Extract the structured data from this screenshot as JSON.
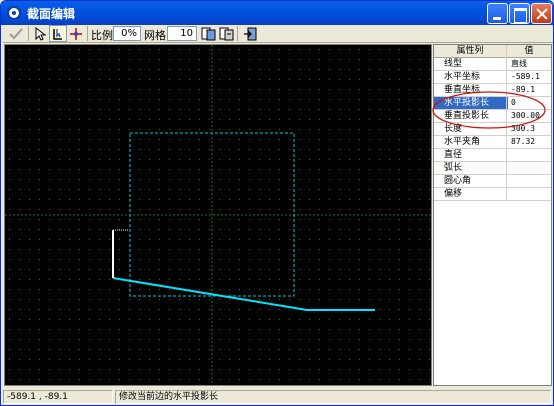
{
  "window": {
    "title": "截面编辑"
  },
  "toolbar": {
    "scale_label": "比例",
    "scale_value": "0%",
    "grid_label": "网格",
    "grid_value": "10"
  },
  "properties": {
    "headers": [
      "属性列",
      "值"
    ],
    "rows": [
      {
        "name": "线型",
        "value": "直线"
      },
      {
        "name": "水平坐标",
        "value": "-589.1"
      },
      {
        "name": "垂直坐标",
        "value": "-89.1"
      },
      {
        "name": "水平投影长",
        "value": "0"
      },
      {
        "name": "垂直投影长",
        "value": "300.00"
      },
      {
        "name": "长度",
        "value": "300.3"
      },
      {
        "name": "水平夹角",
        "value": "87.32"
      },
      {
        "name": "直径",
        "value": ""
      },
      {
        "name": "弧长",
        "value": ""
      },
      {
        "name": "圆心角",
        "value": ""
      },
      {
        "name": "偏移",
        "value": ""
      }
    ],
    "selected_row": "水平投影长"
  },
  "status": {
    "coords": "-589.1 , -89.1",
    "message": "修改当前边的水平投影长"
  },
  "colors": {
    "canvas_bg": "#000000",
    "grid_dot": "#5a5a5a",
    "axis": "#1f7a1f",
    "profile_line": "#00e5ff",
    "selected_edge": "#ffffff",
    "annotation": "#d01010"
  }
}
